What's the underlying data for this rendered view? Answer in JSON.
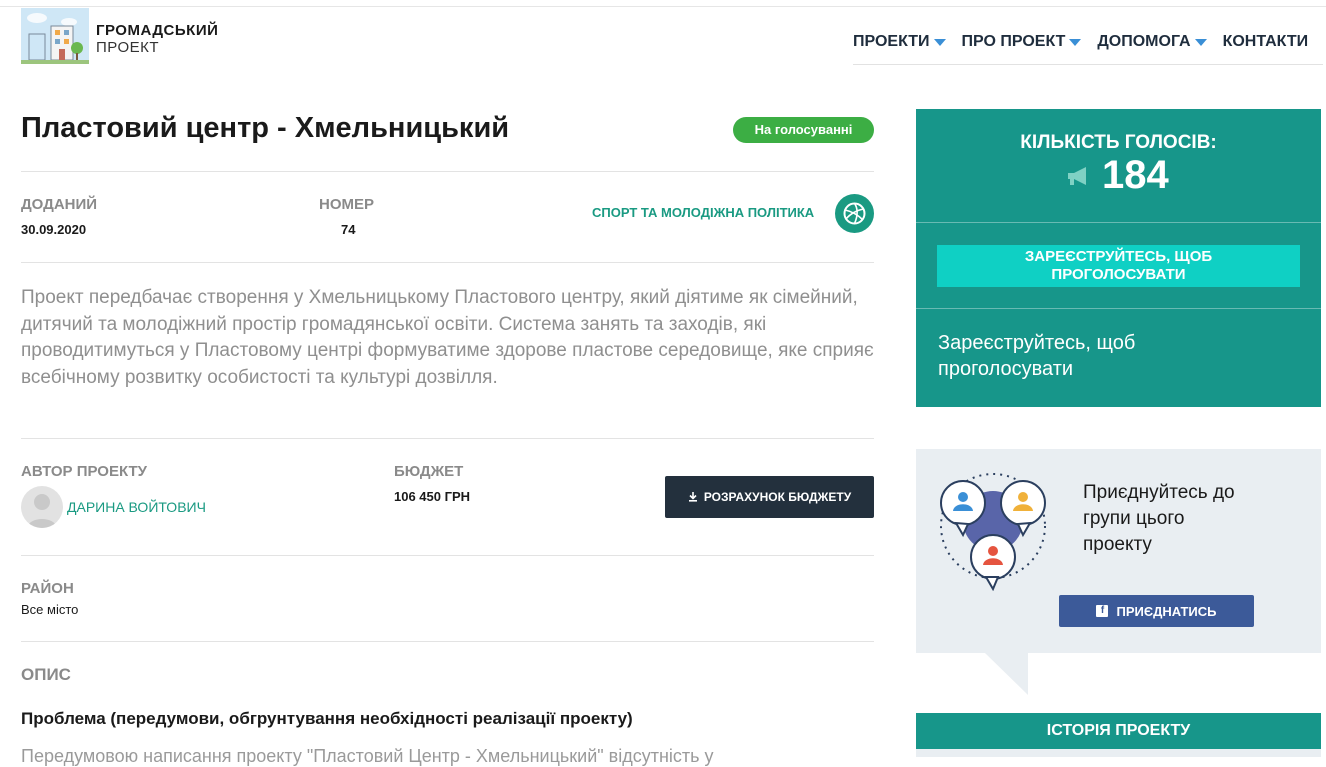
{
  "header": {
    "logo_line1": "ГРОМАДСЬКИЙ",
    "logo_line2": "ПРОЕКТ",
    "nav": [
      {
        "label": "ПРОЕКТИ",
        "dropdown": true
      },
      {
        "label": "ПРО ПРОЕКТ",
        "dropdown": true
      },
      {
        "label": "ДОПОМОГА",
        "dropdown": true
      },
      {
        "label": "КОНТАКТИ",
        "dropdown": false
      }
    ]
  },
  "project": {
    "title": "Пластовий центр - Хмельницький",
    "status": "На голосуванні",
    "added_label": "ДОДАНИЙ",
    "added_value": "30.09.2020",
    "number_label": "НОМЕР",
    "number_value": "74",
    "category": "СПОРТ ТА МОЛОДІЖНА ПОЛІТИКА",
    "summary": "Проект передбачає створення у Хмельницькому Пластового центру, який діятиме як сімейний, дитячий та молодіжний простір громадянської освіти. Система занять та заходів, які проводитимуться у Пластовому центрі формуватиме здорове пластове середовище, яке сприяє всебічному розвитку особистості та культурі дозвілля.",
    "author_label": "АВТОР ПРОЕКТУ",
    "author_name": "ДАРИНА ВОЙТОВИЧ",
    "budget_label": "БЮДЖЕТ",
    "budget_value": "106 450 ГРН",
    "budget_button": "РОЗРАХУНОК БЮДЖЕТУ",
    "district_label": "РАЙОН",
    "district_value": "Все місто",
    "description_heading": "ОПИС",
    "problem_heading": "Проблема (передумови, обгрунтування необхідності реалізації проекту)",
    "problem_text_cut": "Передумовою написання проекту \"Пластовий Центр - Хмельницький\" відсутність у"
  },
  "sidebar": {
    "votes_label": "КІЛЬКІСТЬ ГОЛОСІВ:",
    "votes_count": "184",
    "register_button": "ЗАРЕЄСТРУЙТЕСЬ, ЩОБ ПРОГОЛОСУВАТИ",
    "register_note": "Зареєструйтесь, щоб проголосувати",
    "group_text": "Приєднуйтесь до групи цього проекту",
    "join_button": "ПРИЄДНАТИСЬ",
    "history_title": "ІСТОРІЯ ПРОЕКТУ"
  },
  "colors": {
    "teal": "#17968a",
    "status_green": "#3cae44",
    "dark_button": "#23303d",
    "facebook": "#3c5a99",
    "link_teal": "#1a9a82"
  }
}
